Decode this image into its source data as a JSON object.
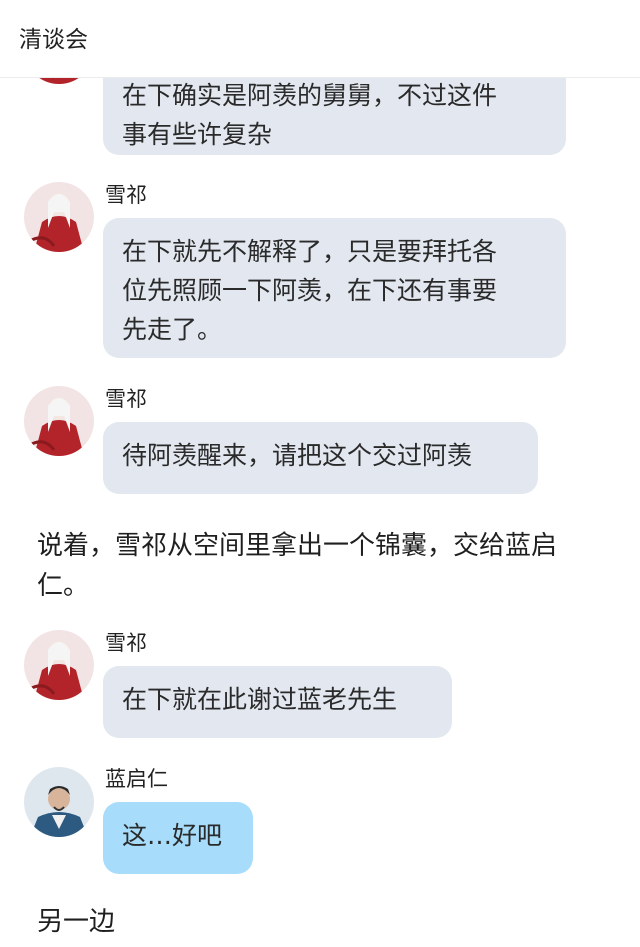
{
  "header": {
    "title": "清谈会"
  },
  "messages": [
    {
      "type": "bubble",
      "sender": "",
      "lines": [
        "在下确实是阿羡的舅舅，不过这件",
        "事有些许复杂"
      ],
      "partial_top": true
    },
    {
      "type": "bubble",
      "sender": "雪祁",
      "lines": [
        "在下就先不解释了，只是要拜托各",
        "位先照顾一下阿羡，在下还有事要",
        "先走了。"
      ]
    },
    {
      "type": "bubble",
      "sender": "雪祁",
      "lines": [
        "待阿羡醒来，请把这个交过阿羡"
      ]
    },
    {
      "type": "narration",
      "lines": [
        "说着，雪祁从空间里拿出一个锦囊，交给蓝启",
        "仁。"
      ]
    },
    {
      "type": "bubble",
      "sender": "雪祁",
      "lines": [
        "在下就在此谢过蓝老先生"
      ]
    },
    {
      "type": "bubble",
      "sender": "蓝启仁",
      "lines": [
        "这…好吧"
      ],
      "color": "#a7ddfb"
    },
    {
      "type": "narration",
      "lines": [
        "另一边"
      ]
    }
  ],
  "colors": {
    "bubble_gray": "#e3e8f0",
    "bubble_blue": "#a7ddfb",
    "avatar_red": "#b3242a"
  }
}
